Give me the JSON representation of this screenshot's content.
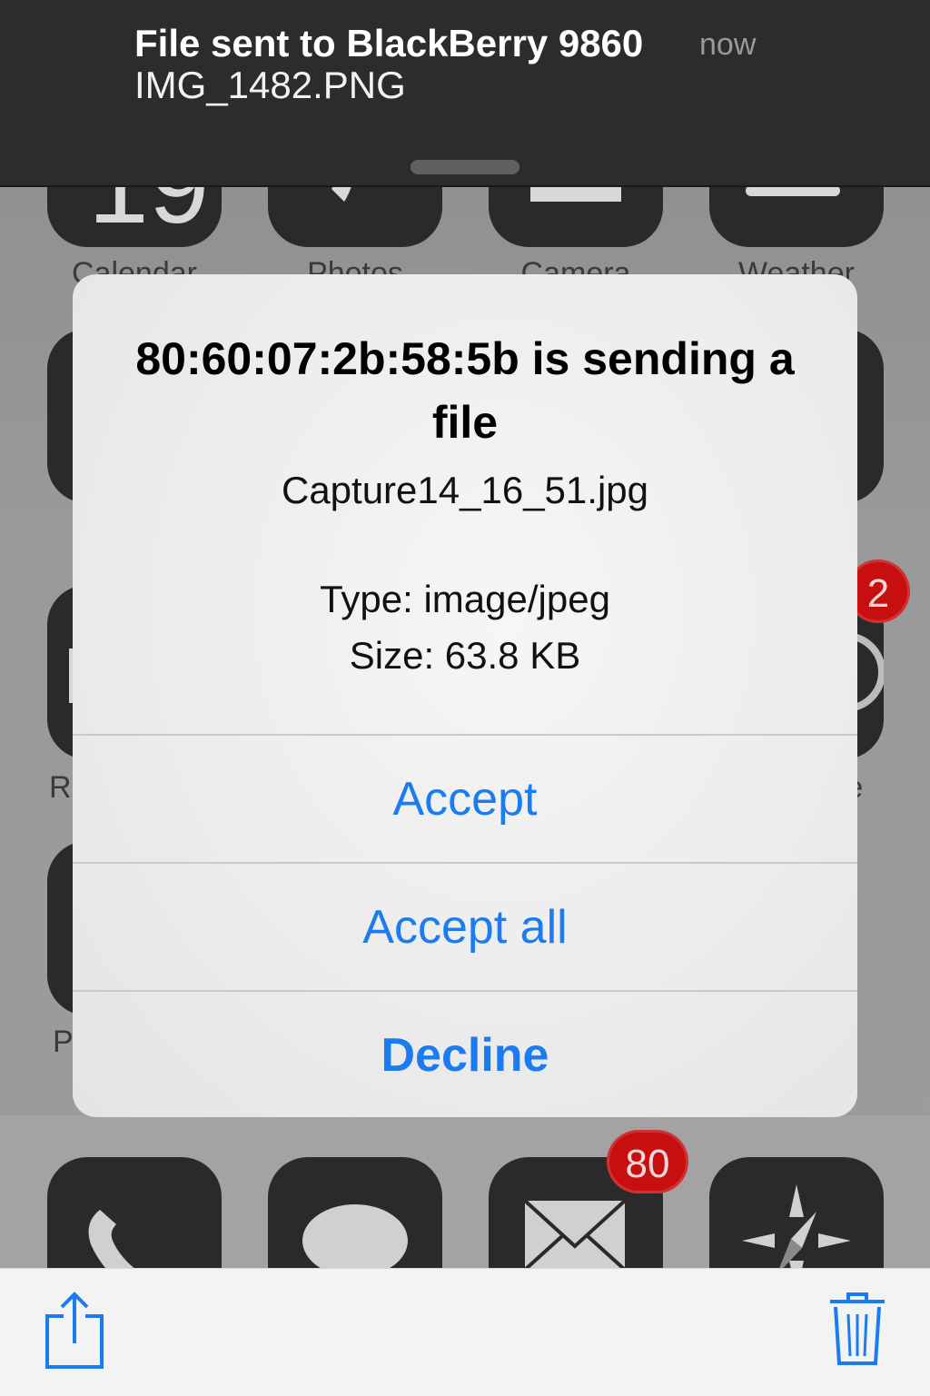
{
  "notification": {
    "title": "File sent to BlackBerry 9860",
    "time": "now",
    "body": "IMG_1482.PNG"
  },
  "homescreen": {
    "top_row_labels": [
      "Calendar",
      "Photos",
      "Camera",
      "Weather"
    ],
    "partial_labels": {
      "row3_left": "R",
      "row3_right": "re",
      "row4_left": "P"
    },
    "badges": {
      "right_icon": "2",
      "mail": "80"
    },
    "dock_icons": [
      "phone-icon",
      "messages-icon",
      "mail-icon",
      "safari-icon"
    ]
  },
  "alert": {
    "title": "80:60:07:2b:58:5b is sending a file",
    "filename": "Capture14_16_51.jpg",
    "type": "Type: image/jpeg",
    "size": "Size: 63.8 KB",
    "buttons": {
      "accept": "Accept",
      "accept_all": "Accept all",
      "decline": "Decline"
    }
  },
  "toolbar": {
    "left_icon": "share-icon",
    "right_icon": "trash-icon"
  },
  "colors": {
    "accent": "#1a7cf0",
    "badge": "#c80f10",
    "banner": "#2b2c2e"
  }
}
